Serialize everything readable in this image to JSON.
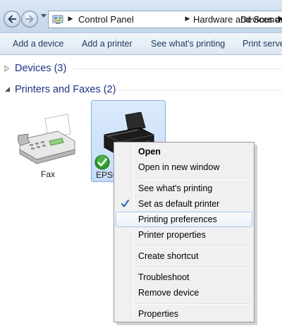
{
  "address_bar": {
    "breadcrumbs": [
      "Control Panel",
      "Hardware and Sound",
      "Devices and"
    ],
    "icon": "control-panel-icon"
  },
  "command_bar": {
    "items": [
      "Add a device",
      "Add a printer",
      "See what's printing",
      "Print serve"
    ]
  },
  "groups": {
    "devices": {
      "label": "Devices (3)",
      "expanded": false
    },
    "printers": {
      "label": "Printers and Faxes (2)",
      "expanded": true
    }
  },
  "printers": [
    {
      "label": "Fax",
      "icon": "fax-machine-icon",
      "selected": false
    },
    {
      "label": "EPSO",
      "icon": "inkjet-printer-icon",
      "selected": true,
      "default_printer": true
    }
  ],
  "context_menu": {
    "items": [
      {
        "label": "Open",
        "bold": true
      },
      {
        "label": "Open in new window"
      },
      {
        "label": "See what's printing"
      },
      {
        "label": "Set as default printer",
        "checked": true
      },
      {
        "label": "Printing preferences",
        "highlighted": true
      },
      {
        "label": "Printer properties"
      },
      {
        "label": "Create shortcut"
      },
      {
        "label": "Troubleshoot"
      },
      {
        "label": "Remove device"
      },
      {
        "label": "Properties"
      }
    ]
  },
  "colors": {
    "group_header_text": "#1e3287",
    "command_text": "#1e395b",
    "selection_fill": "#c4dcf8",
    "menu_highlight_border": "#a8c8eb",
    "default_check": "#2f9a2a"
  }
}
